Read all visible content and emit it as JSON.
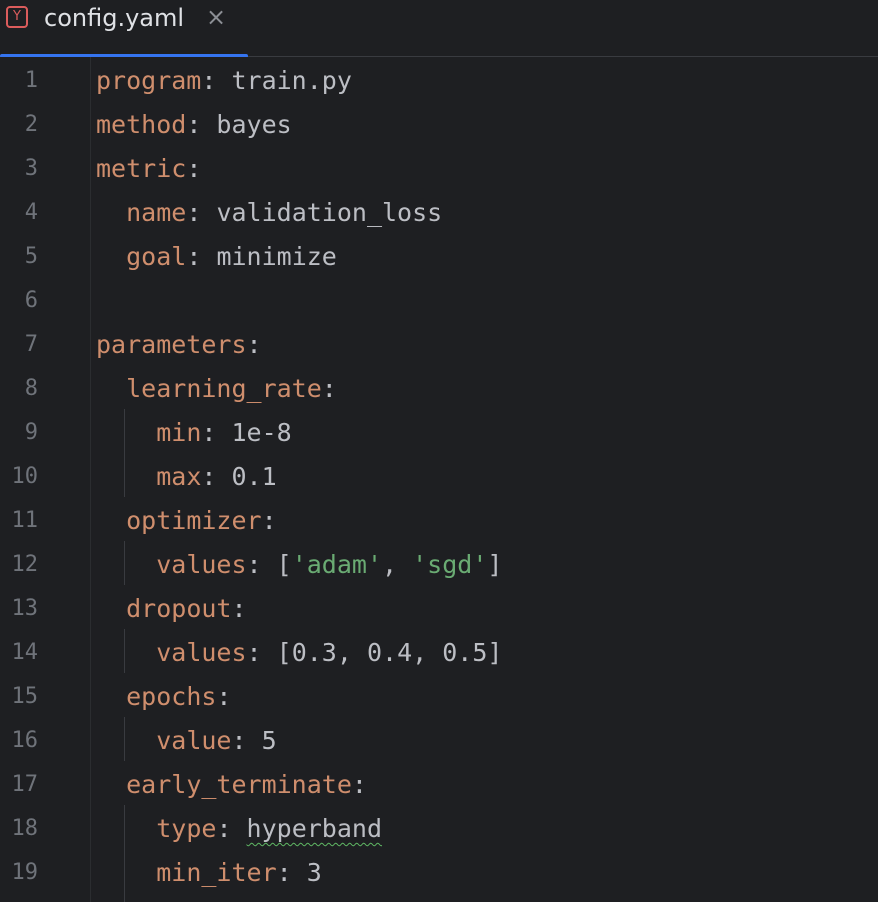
{
  "tab": {
    "icon_letter": "Y",
    "filename": "config.yaml",
    "close_glyph": "×"
  },
  "colors": {
    "background": "#1e1f22",
    "key": "#cf8e6d",
    "string": "#6aab73",
    "text": "#bcbec4",
    "line_number": "#6f737a",
    "tab_accent": "#3574f0",
    "yaml_icon": "#db5c5c"
  },
  "lines": [
    {
      "num": "1",
      "indent": "",
      "key": "program",
      "sep": ": ",
      "value": "train.py"
    },
    {
      "num": "2",
      "indent": "",
      "key": "method",
      "sep": ": ",
      "value": "bayes"
    },
    {
      "num": "3",
      "indent": "",
      "key": "metric",
      "sep": ":",
      "value": ""
    },
    {
      "num": "4",
      "indent": "  ",
      "key": "name",
      "sep": ": ",
      "value": "validation_loss"
    },
    {
      "num": "5",
      "indent": "  ",
      "key": "goal",
      "sep": ": ",
      "value": "minimize"
    },
    {
      "num": "6",
      "indent": "",
      "key": "",
      "sep": "",
      "value": ""
    },
    {
      "num": "7",
      "indent": "",
      "key": "parameters",
      "sep": ":",
      "value": ""
    },
    {
      "num": "8",
      "indent": "  ",
      "key": "learning_rate",
      "sep": ":",
      "value": ""
    },
    {
      "num": "9",
      "indent": "    ",
      "key": "min",
      "sep": ": ",
      "value": "1e-8"
    },
    {
      "num": "10",
      "indent": "    ",
      "key": "max",
      "sep": ": ",
      "value": "0.1"
    },
    {
      "num": "11",
      "indent": "  ",
      "key": "optimizer",
      "sep": ":",
      "value": ""
    },
    {
      "num": "12",
      "indent": "    ",
      "key": "values",
      "sep": ": ",
      "list": [
        "'adam'",
        "'sgd'"
      ],
      "list_kind": "string"
    },
    {
      "num": "13",
      "indent": "  ",
      "key": "dropout",
      "sep": ":",
      "value": ""
    },
    {
      "num": "14",
      "indent": "    ",
      "key": "values",
      "sep": ": ",
      "list": [
        "0.3",
        "0.4",
        "0.5"
      ],
      "list_kind": "number"
    },
    {
      "num": "15",
      "indent": "  ",
      "key": "epochs",
      "sep": ":",
      "value": ""
    },
    {
      "num": "16",
      "indent": "    ",
      "key": "value",
      "sep": ": ",
      "value": "5"
    },
    {
      "num": "17",
      "indent": "  ",
      "key": "early_terminate",
      "sep": ":",
      "value": ""
    },
    {
      "num": "18",
      "indent": "    ",
      "key": "type",
      "sep": ": ",
      "value": "hyperband",
      "typo": true
    },
    {
      "num": "19",
      "indent": "    ",
      "key": "min_iter",
      "sep": ": ",
      "value": "3"
    }
  ]
}
